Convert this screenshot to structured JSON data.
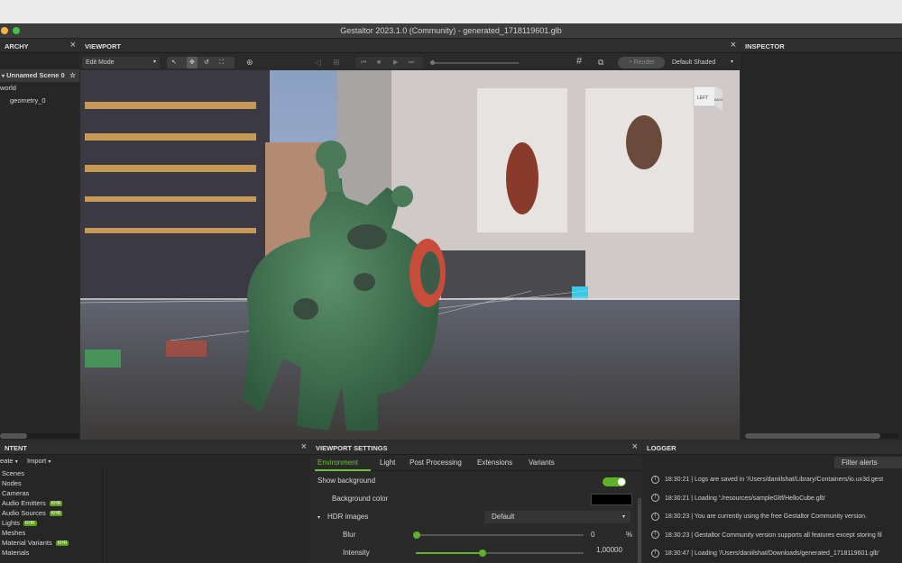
{
  "window": {
    "title": "Gestaltor 2023.1.0 (Community) - generated_1718119601.glb"
  },
  "hierarchy": {
    "title": "ARCHY",
    "items": [
      "Unnamed Scene 0",
      "world",
      "geometry_0"
    ]
  },
  "viewport": {
    "title": "VIEWPORT",
    "mode": "Edit Mode",
    "render_label": "Render",
    "shading": "Default Shaded",
    "cube_face_left": "LEFT",
    "cube_face_right": "BACK"
  },
  "inspector": {
    "title": "INSPECTOR"
  },
  "content": {
    "title": "NTENT",
    "create_label": "eate",
    "import_label": "Import",
    "items": [
      {
        "label": "Scenes",
        "badge": ""
      },
      {
        "label": "Nodes",
        "badge": ""
      },
      {
        "label": "Cameras",
        "badge": ""
      },
      {
        "label": "Audio Emitters",
        "badge": "KHR"
      },
      {
        "label": "Audio Sources",
        "badge": "KHR"
      },
      {
        "label": "Lights",
        "badge": "KHR"
      },
      {
        "label": "Meshes",
        "badge": ""
      },
      {
        "label": "Material Variants",
        "badge": "KHR"
      },
      {
        "label": "Materials",
        "badge": ""
      }
    ]
  },
  "settings": {
    "title": "VIEWPORT SETTINGS",
    "tabs": [
      "Environment",
      "Light",
      "Post Processing",
      "Extensions",
      "Variants"
    ],
    "show_background": "Show background",
    "background_color": "Background color",
    "hdr_images": "HDR images",
    "hdr_value": "Default",
    "blur": "Blur",
    "blur_value": "0",
    "blur_unit": "%",
    "intensity": "Intensity",
    "intensity_value": "1,00000",
    "intensity_fraction": 0.4
  },
  "logger": {
    "title": "LOGGER",
    "filter_label": "Filter alerts",
    "rows": [
      "18:30:21 | Logs are saved in '/Users/daniilshat/Library/Containers/io.ux3d.gest",
      "18:30:21 | Loading ':/resources/sampleGltf/HelloCube.glb'",
      "18:30:23 | You are currently using the free Gestaltor Community version.",
      "18:30:23 | Gestaltor Community version supports all features except storing fil",
      "18:30:47 | Loading '/Users/daniilshat/Downloads/generated_1718119601.glb'"
    ]
  },
  "colors": {
    "accent": "#5fb32b",
    "panel": "#262626",
    "header": "#2e2e2e"
  }
}
